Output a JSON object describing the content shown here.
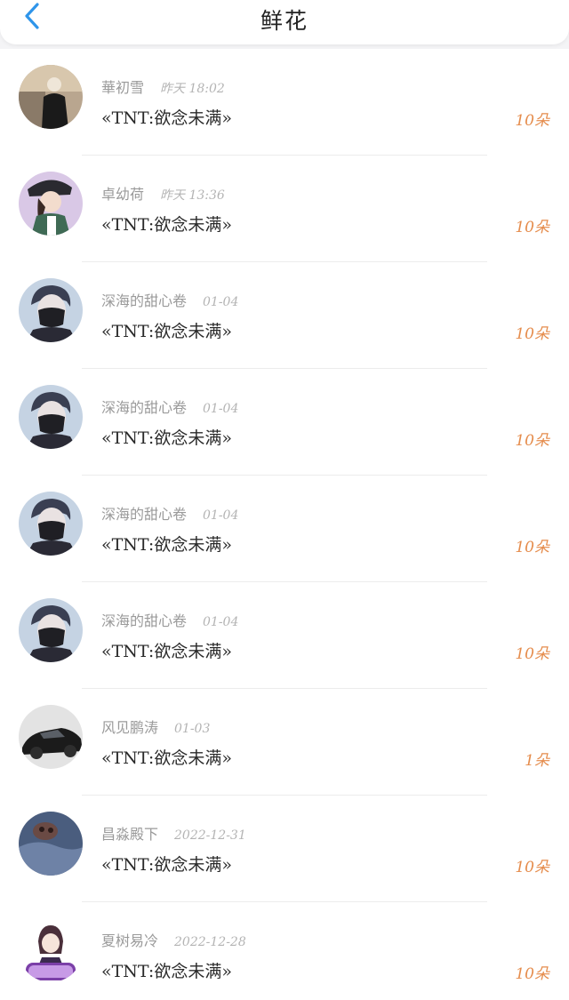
{
  "header": {
    "title": "鲜花",
    "back_icon": "chevron-left-icon",
    "accent_color": "#2f95ea"
  },
  "colors": {
    "count": "#e58c4c",
    "meta": "#9a9a9a"
  },
  "items": [
    {
      "user": "華初雪",
      "time": "昨天 18:02",
      "book": "«TNT:欲念未满»",
      "count": "10朵",
      "avatar": "person-dark-coat"
    },
    {
      "user": "卓幼荷",
      "time": "昨天 13:36",
      "book": "«TNT:欲念未满»",
      "count": "10朵",
      "avatar": "anime-girl-cap"
    },
    {
      "user": "深海的甜心卷",
      "time": "01-04",
      "book": "«TNT:欲念未满»",
      "count": "10朵",
      "avatar": "masked-boy"
    },
    {
      "user": "深海的甜心卷",
      "time": "01-04",
      "book": "«TNT:欲念未满»",
      "count": "10朵",
      "avatar": "masked-boy"
    },
    {
      "user": "深海的甜心卷",
      "time": "01-04",
      "book": "«TNT:欲念未满»",
      "count": "10朵",
      "avatar": "masked-boy"
    },
    {
      "user": "深海的甜心卷",
      "time": "01-04",
      "book": "«TNT:欲念未满»",
      "count": "10朵",
      "avatar": "masked-boy"
    },
    {
      "user": "风见鹏涛",
      "time": "01-03",
      "book": "«TNT:欲念未满»",
      "count": "1朵",
      "avatar": "black-car"
    },
    {
      "user": "昌淼殿下",
      "time": "2022-12-31",
      "book": "«TNT:欲念未满»",
      "count": "10朵",
      "avatar": "cat-blanket"
    },
    {
      "user": "夏树易冷",
      "time": "2022-12-28",
      "book": "«TNT:欲念未满»",
      "count": "10朵",
      "avatar": "chibi-girl-purple"
    }
  ]
}
